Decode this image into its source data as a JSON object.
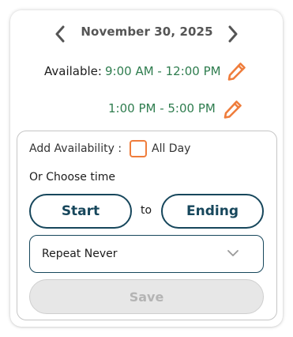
{
  "header": {
    "date": "November 30, 2025",
    "prev_icon": "chevron-left-icon",
    "next_icon": "chevron-right-icon"
  },
  "availability": {
    "label": "Available:",
    "slots": [
      {
        "time": "9:00 AM - 12:00 PM",
        "edit_icon": "pencil-icon"
      },
      {
        "time": "1:00 PM - 5:00 PM",
        "edit_icon": "pencil-icon"
      }
    ]
  },
  "add_panel": {
    "add_label": "Add Availability :",
    "all_day_label": "All Day",
    "all_day_checked": false,
    "choose_label": "Or Choose time",
    "start_label": "Start",
    "to_label": "to",
    "ending_label": "Ending",
    "repeat_value": "Repeat Never",
    "save_label": "Save",
    "save_disabled": true
  },
  "colors": {
    "accent_orange": "#ef7d3c",
    "slot_green": "#2f7d4f",
    "primary_dark": "#17475c",
    "disabled_gray": "#e7e7e7"
  }
}
